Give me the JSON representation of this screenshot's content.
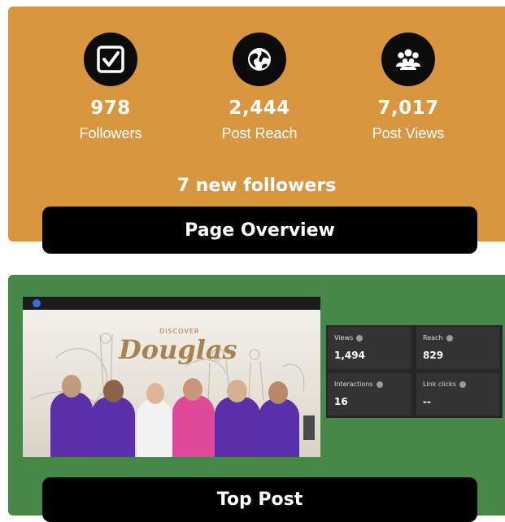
{
  "overview": {
    "stats": [
      {
        "icon": "checkbox-icon",
        "value": "978",
        "label": "Followers"
      },
      {
        "icon": "globe-icon",
        "value": "2,444",
        "label": "Post Reach"
      },
      {
        "icon": "people-group-icon",
        "value": "7,017",
        "label": "Post Views"
      }
    ],
    "new_followers": "7 new followers",
    "title": "Page Overview"
  },
  "top_post": {
    "image": {
      "discover_text": "DISCOVER",
      "brand_text": "Douglas"
    },
    "metrics": [
      {
        "label": "Views",
        "value": "1,494"
      },
      {
        "label": "Reach",
        "value": "829"
      },
      {
        "label": "Interactions",
        "value": "16"
      },
      {
        "label": "Link clicks",
        "value": "--"
      }
    ],
    "title": "Top Post"
  },
  "colors": {
    "overview_bg": "#d8963f",
    "top_post_bg": "#46874a",
    "pill_bg": "#000000"
  }
}
